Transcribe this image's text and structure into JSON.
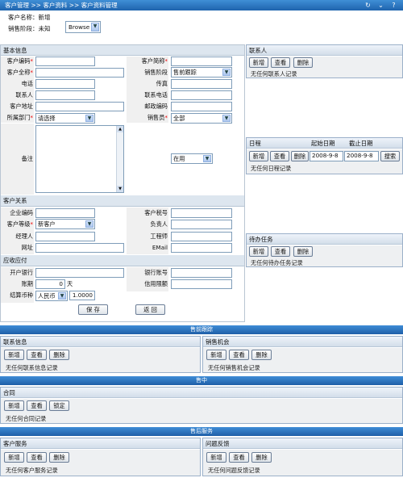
{
  "titlebar": {
    "breadcrumb": "客户管理 >> 客户资料 >> 客户资料管理"
  },
  "header": {
    "name_label": "客户名称：",
    "name_value": "新增",
    "stage_label": "销售阶段：",
    "stage_value": "未知",
    "browse_value": "Browse"
  },
  "basic": {
    "title": "基本信息",
    "code_label": "客户编码",
    "short_label": "客户简称",
    "fullname_label": "客户全称",
    "stage_label": "销售阶段",
    "stage_value": "售前跟踪",
    "phone_label": "电话",
    "fax_label": "传真",
    "contact_label": "联系人",
    "contact_phone_label": "联系电话",
    "address_label": "客户地址",
    "zip_label": "邮政编码",
    "dept_label": "所属部门",
    "dept_value": "请选择",
    "sales_label": "销售员",
    "sales_value": "全部",
    "remark_label": "备注",
    "status_value": "在用"
  },
  "relation": {
    "title": "客户关系",
    "company_code_label": "企业编码",
    "tax_label": "客户税号",
    "level_label": "客户等级",
    "level_value": "新客户",
    "owner_label": "负责人",
    "manager_label": "经理人",
    "engineer_label": "工程师",
    "web_label": "网址",
    "email_label": "EMail"
  },
  "finance": {
    "title": "应收应付",
    "bank_label": "开户银行",
    "account_label": "银行账号",
    "period_label": "账期",
    "period_value": "0",
    "period_unit": "天",
    "credit_label": "信用限额",
    "currency_label": "结算币种",
    "currency_value": "人民币",
    "rate_value": "1.0000"
  },
  "actions": {
    "save": "保 存",
    "back": "返 回"
  },
  "contacts_panel": {
    "title": "联系人",
    "add": "新增",
    "view": "查看",
    "del": "删除",
    "empty": "无任何联系人记录"
  },
  "schedule_panel": {
    "title": "日程",
    "start_label": "起始日期",
    "end_label": "截止日期",
    "add": "新增",
    "view": "查看",
    "del": "删除",
    "start_value": "2008-9-8",
    "end_value": "2008-9-8",
    "search": "搜索",
    "empty": "无任何日程记录"
  },
  "todo_panel": {
    "title": "待办任务",
    "add": "新增",
    "view": "查看",
    "del": "删除",
    "empty": "无任何待办任务记录"
  },
  "presale": {
    "bar": "售前跟踪",
    "contact_info": {
      "title": "联系信息",
      "add": "新增",
      "view": "查看",
      "del": "删除",
      "empty": "无任何联系信息记录"
    },
    "opportunity": {
      "title": "销售机会",
      "add": "新增",
      "view": "查看",
      "del": "删除",
      "empty": "无任何销售机会记录"
    }
  },
  "insale": {
    "bar": "售中",
    "contract": {
      "title": "合同",
      "add": "新增",
      "view": "查看",
      "lock": "锁定",
      "empty": "无任何合同记录"
    }
  },
  "aftersale": {
    "bar": "售后服务",
    "service": {
      "title": "客户服务",
      "add": "新增",
      "view": "查看",
      "del": "删除",
      "empty": "无任何客户服务记录"
    },
    "feedback": {
      "title": "问题反馈",
      "add": "新增",
      "view": "查看",
      "del": "删除",
      "empty": "无任何问题反馈记录"
    }
  }
}
